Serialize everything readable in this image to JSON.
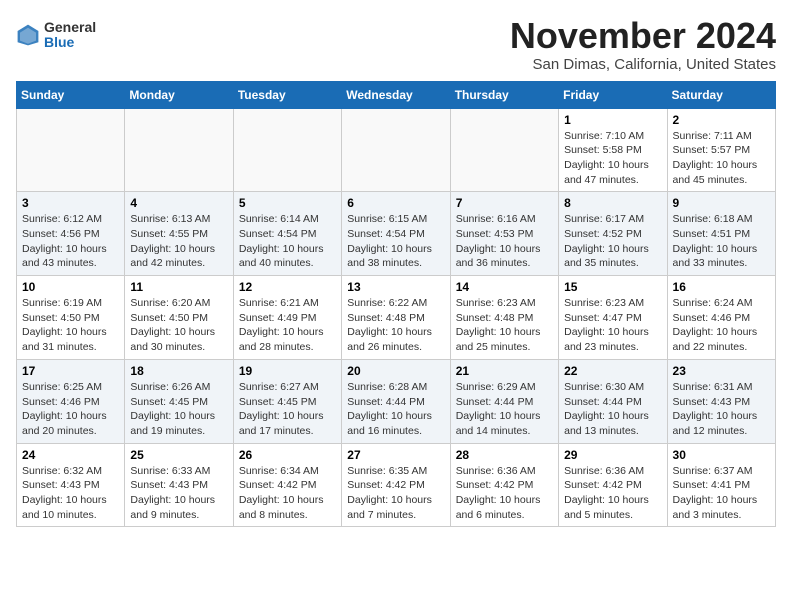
{
  "header": {
    "logo_general": "General",
    "logo_blue": "Blue",
    "title": "November 2024",
    "location": "San Dimas, California, United States"
  },
  "calendar": {
    "weekdays": [
      "Sunday",
      "Monday",
      "Tuesday",
      "Wednesday",
      "Thursday",
      "Friday",
      "Saturday"
    ],
    "weeks": [
      [
        {
          "day": "",
          "info": ""
        },
        {
          "day": "",
          "info": ""
        },
        {
          "day": "",
          "info": ""
        },
        {
          "day": "",
          "info": ""
        },
        {
          "day": "",
          "info": ""
        },
        {
          "day": "1",
          "info": "Sunrise: 7:10 AM\nSunset: 5:58 PM\nDaylight: 10 hours and 47 minutes."
        },
        {
          "day": "2",
          "info": "Sunrise: 7:11 AM\nSunset: 5:57 PM\nDaylight: 10 hours and 45 minutes."
        }
      ],
      [
        {
          "day": "3",
          "info": "Sunrise: 6:12 AM\nSunset: 4:56 PM\nDaylight: 10 hours and 43 minutes."
        },
        {
          "day": "4",
          "info": "Sunrise: 6:13 AM\nSunset: 4:55 PM\nDaylight: 10 hours and 42 minutes."
        },
        {
          "day": "5",
          "info": "Sunrise: 6:14 AM\nSunset: 4:54 PM\nDaylight: 10 hours and 40 minutes."
        },
        {
          "day": "6",
          "info": "Sunrise: 6:15 AM\nSunset: 4:54 PM\nDaylight: 10 hours and 38 minutes."
        },
        {
          "day": "7",
          "info": "Sunrise: 6:16 AM\nSunset: 4:53 PM\nDaylight: 10 hours and 36 minutes."
        },
        {
          "day": "8",
          "info": "Sunrise: 6:17 AM\nSunset: 4:52 PM\nDaylight: 10 hours and 35 minutes."
        },
        {
          "day": "9",
          "info": "Sunrise: 6:18 AM\nSunset: 4:51 PM\nDaylight: 10 hours and 33 minutes."
        }
      ],
      [
        {
          "day": "10",
          "info": "Sunrise: 6:19 AM\nSunset: 4:50 PM\nDaylight: 10 hours and 31 minutes."
        },
        {
          "day": "11",
          "info": "Sunrise: 6:20 AM\nSunset: 4:50 PM\nDaylight: 10 hours and 30 minutes."
        },
        {
          "day": "12",
          "info": "Sunrise: 6:21 AM\nSunset: 4:49 PM\nDaylight: 10 hours and 28 minutes."
        },
        {
          "day": "13",
          "info": "Sunrise: 6:22 AM\nSunset: 4:48 PM\nDaylight: 10 hours and 26 minutes."
        },
        {
          "day": "14",
          "info": "Sunrise: 6:23 AM\nSunset: 4:48 PM\nDaylight: 10 hours and 25 minutes."
        },
        {
          "day": "15",
          "info": "Sunrise: 6:23 AM\nSunset: 4:47 PM\nDaylight: 10 hours and 23 minutes."
        },
        {
          "day": "16",
          "info": "Sunrise: 6:24 AM\nSunset: 4:46 PM\nDaylight: 10 hours and 22 minutes."
        }
      ],
      [
        {
          "day": "17",
          "info": "Sunrise: 6:25 AM\nSunset: 4:46 PM\nDaylight: 10 hours and 20 minutes."
        },
        {
          "day": "18",
          "info": "Sunrise: 6:26 AM\nSunset: 4:45 PM\nDaylight: 10 hours and 19 minutes."
        },
        {
          "day": "19",
          "info": "Sunrise: 6:27 AM\nSunset: 4:45 PM\nDaylight: 10 hours and 17 minutes."
        },
        {
          "day": "20",
          "info": "Sunrise: 6:28 AM\nSunset: 4:44 PM\nDaylight: 10 hours and 16 minutes."
        },
        {
          "day": "21",
          "info": "Sunrise: 6:29 AM\nSunset: 4:44 PM\nDaylight: 10 hours and 14 minutes."
        },
        {
          "day": "22",
          "info": "Sunrise: 6:30 AM\nSunset: 4:44 PM\nDaylight: 10 hours and 13 minutes."
        },
        {
          "day": "23",
          "info": "Sunrise: 6:31 AM\nSunset: 4:43 PM\nDaylight: 10 hours and 12 minutes."
        }
      ],
      [
        {
          "day": "24",
          "info": "Sunrise: 6:32 AM\nSunset: 4:43 PM\nDaylight: 10 hours and 10 minutes."
        },
        {
          "day": "25",
          "info": "Sunrise: 6:33 AM\nSunset: 4:43 PM\nDaylight: 10 hours and 9 minutes."
        },
        {
          "day": "26",
          "info": "Sunrise: 6:34 AM\nSunset: 4:42 PM\nDaylight: 10 hours and 8 minutes."
        },
        {
          "day": "27",
          "info": "Sunrise: 6:35 AM\nSunset: 4:42 PM\nDaylight: 10 hours and 7 minutes."
        },
        {
          "day": "28",
          "info": "Sunrise: 6:36 AM\nSunset: 4:42 PM\nDaylight: 10 hours and 6 minutes."
        },
        {
          "day": "29",
          "info": "Sunrise: 6:36 AM\nSunset: 4:42 PM\nDaylight: 10 hours and 5 minutes."
        },
        {
          "day": "30",
          "info": "Sunrise: 6:37 AM\nSunset: 4:41 PM\nDaylight: 10 hours and 3 minutes."
        }
      ]
    ]
  }
}
